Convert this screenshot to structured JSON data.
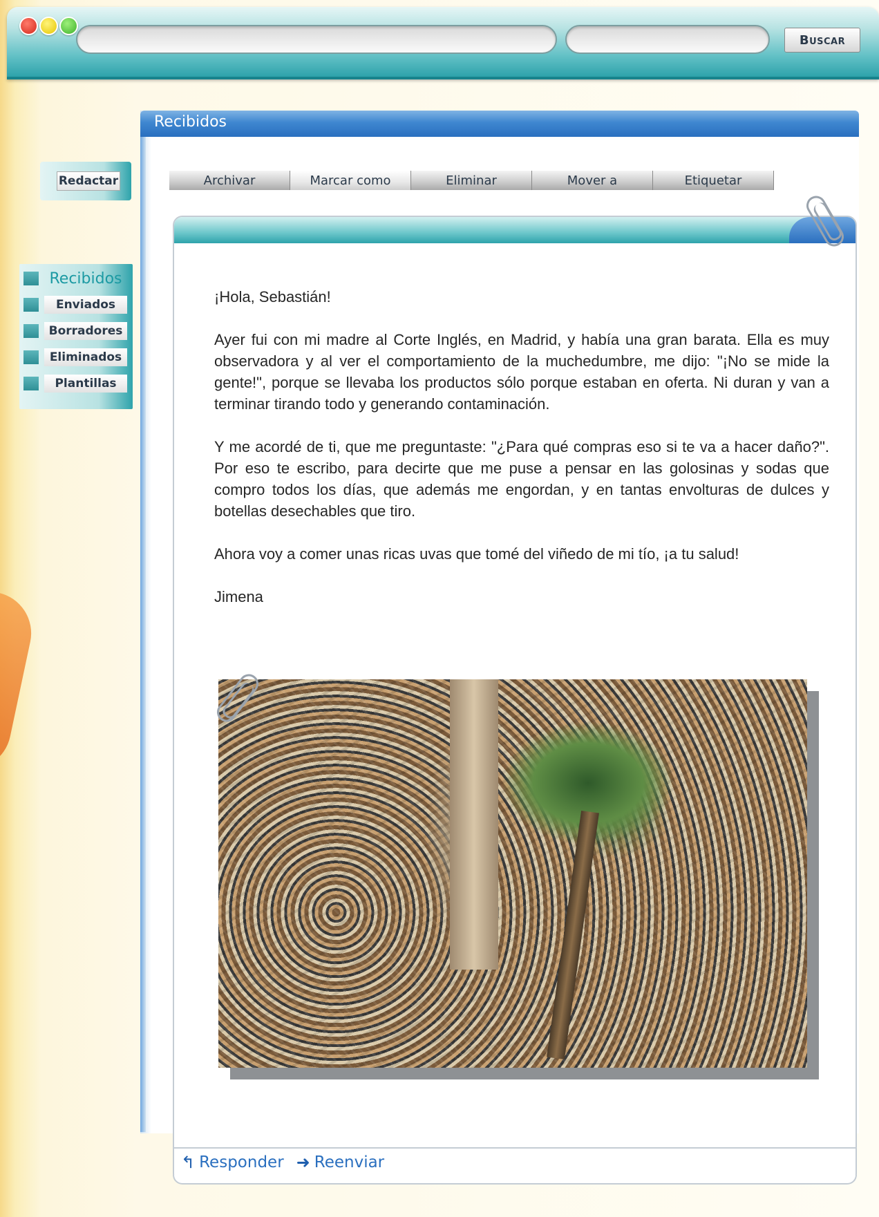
{
  "browser": {
    "search_button_label": "Buscar"
  },
  "mailbox": {
    "header_title": "Recibidos",
    "compose_label": "Redactar",
    "folders": [
      {
        "label": "Recibidos",
        "active": true
      },
      {
        "label": "Enviados"
      },
      {
        "label": "Borradores"
      },
      {
        "label": "Eliminados"
      },
      {
        "label": "Plantillas"
      }
    ],
    "toolbar": [
      "Archivar",
      "Marcar como",
      "Eliminar",
      "Mover a",
      "Etiquetar"
    ]
  },
  "message": {
    "greeting": "¡Hola, Sebastián!",
    "paragraph_1": "Ayer fui con mi madre al Corte Inglés, en Madrid, y había una gran barata. Ella es muy observadora y al ver el comportamiento de la muchedumbre, me dijo: \"¡No se mide la gente!\", porque se llevaba los productos sólo porque estaban en oferta. Ni duran y van a terminar tirando todo y generando contaminación.",
    "paragraph_2": "Y me acordé de ti, que me preguntaste: \"¿Para qué compras eso si te va a hacer daño?\". Por eso te escribo, para decirte que me puse a pensar en las golosinas y sodas que compro todos los días, que además me engordan, y en tantas envolturas de dulces y botellas desechables que tiro.",
    "paragraph_3": "Ahora voy a comer unas ricas uvas que tomé del viñedo de mi tío, ¡a tu salud!",
    "signature": "Jimena"
  },
  "actions": {
    "reply_label": "Responder",
    "forward_label": "Reenviar"
  },
  "colors": {
    "accent_teal": "#2ea3ab",
    "header_blue": "#2a6fbf",
    "link_blue": "#2a6fbf"
  }
}
